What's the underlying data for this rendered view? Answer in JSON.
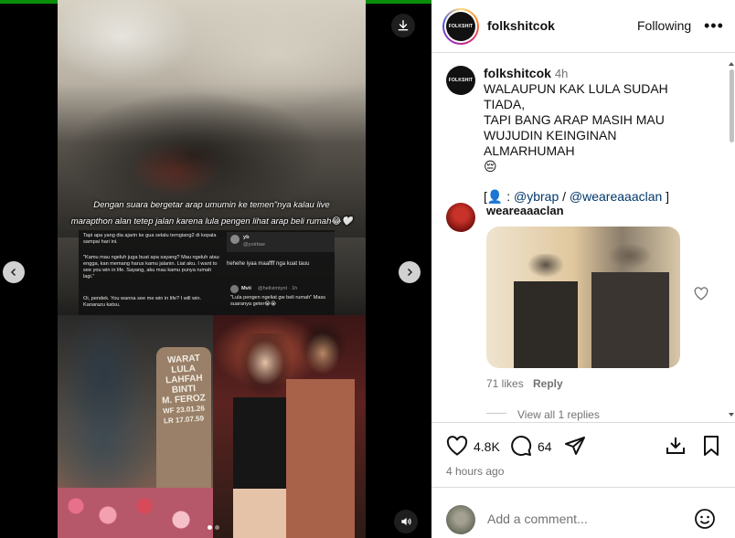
{
  "media": {
    "caption_line1": "Dengan suara bergetar arap umumin ke temen\"nya kalau live",
    "caption_line2": "marapthon alan tetep jalan karena lula pengen lihat arap beli rumah😂🤍",
    "screenshot": {
      "quote1": "Tapi apa yang dia ajarin ke gua selalu terngiang2 di kepala sampai hari ini.",
      "quote2": "\"Kamu mau ngeluh juga buat apa sayang? Mau ngeluh atau engga, kan memang harus kamu jalanin. Liat aku. I want to see you win in life. Sayang, aku mau kamu punya rumah lagi.\"",
      "quote3": "Oi, pendek. You wanna see me win in life? I will win. Kanarazu katsu.",
      "reply_user": "yb",
      "reply_handle": "@yoirbae",
      "reply_text": "hehehe iyaa maaffff nga kuat tauu",
      "reply2_user": "Mvii",
      "reply2_handle": "@helivimtynt · 1h",
      "reply2_text": "\"Lula pengen ngeliat gw beli rumah\" Mass suaranya geter😭😭"
    },
    "grave_sign": [
      "WARAT",
      "LULA LAHFAH",
      "BINTI",
      "M. FEROZ",
      "WF 23.01.26",
      "LR 17.07.59"
    ],
    "current_slide": 1,
    "slide_count": 2
  },
  "post": {
    "username": "folkshitcok",
    "avatar_text": "FOLKSHIT",
    "follow_label": "Following",
    "more_label": "•••",
    "caption": {
      "username": "folkshitcok",
      "time": "4h",
      "lines": [
        "WALAUPUN KAK LULA SUDAH TIADA,",
        "TAPI BANG ARAP MASIH MAU",
        "WUJUDIN KEINGINAN ALMARHUMAH",
        "😔"
      ],
      "credit_open": "[👤 : ",
      "mention1": "@ybrap",
      "sep": " / ",
      "mention2": "@weareaaaclan",
      "credit_close": " ]"
    },
    "comment": {
      "username": "weareaaaclan",
      "likes": "71 likes",
      "reply_label": "Reply",
      "view_replies": "View all 1 replies"
    },
    "likes_count": "4.8K",
    "comments_count": "64",
    "posted_ago": "4 hours ago",
    "add_comment_placeholder": "Add a comment...",
    "colors": {
      "link": "#00376b",
      "muted": "#737373",
      "divider": "#dbdbdb"
    }
  }
}
